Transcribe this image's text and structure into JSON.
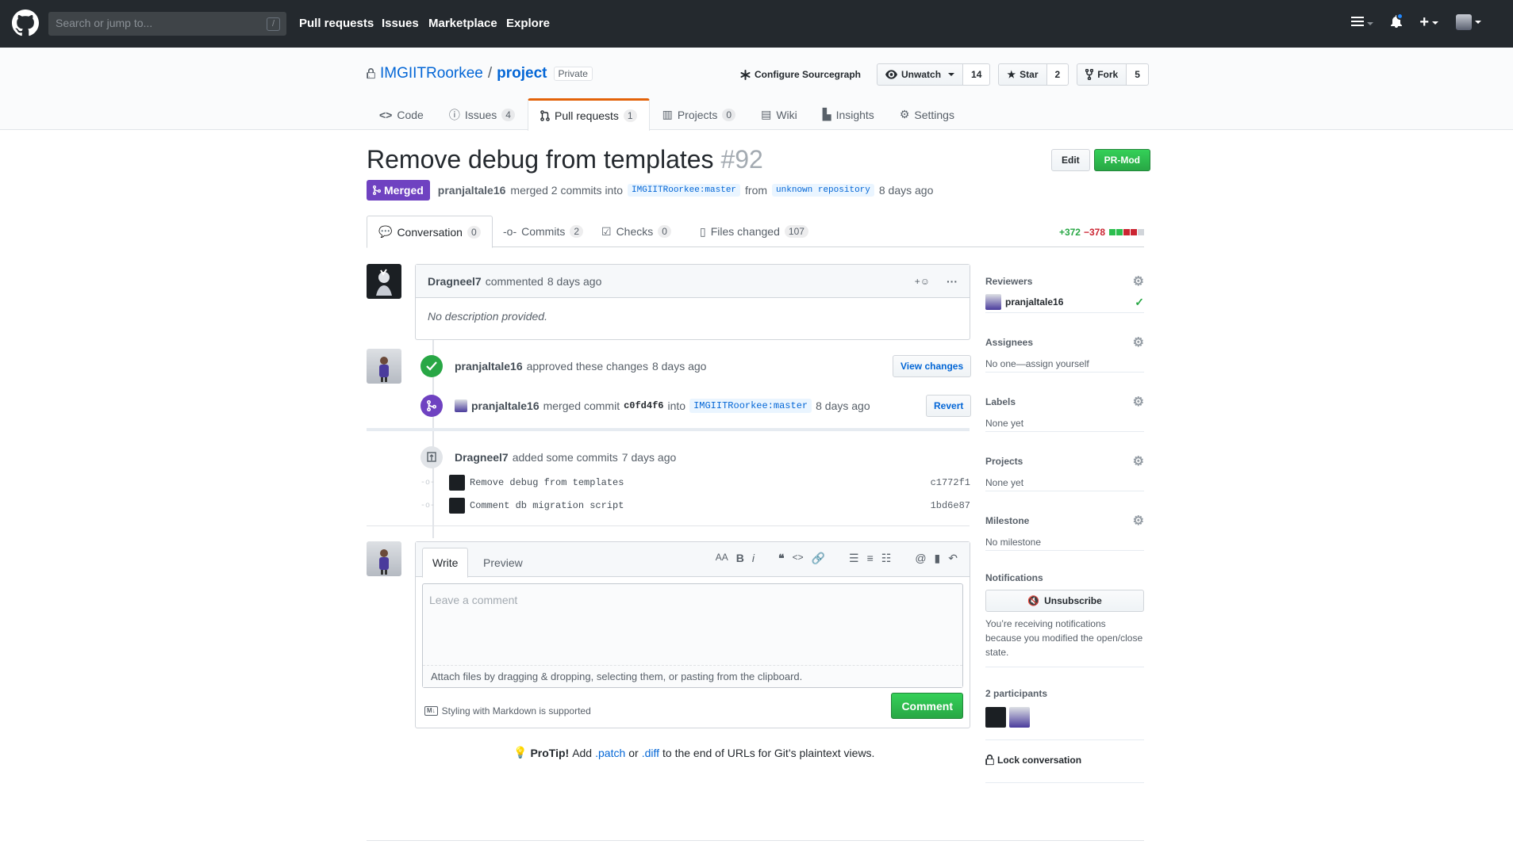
{
  "header": {
    "search_placeholder": "Search or jump to...",
    "search_shortcut": "/",
    "nav": [
      "Pull requests",
      "Issues",
      "Marketplace",
      "Explore"
    ]
  },
  "repo": {
    "owner": "IMGIITRoorkee",
    "separator": "/",
    "name": "project",
    "visibility": "Private",
    "sourcegraph_label": "Configure Sourcegraph",
    "watch_label": "Unwatch",
    "watch_count": "14",
    "star_label": "Star",
    "star_count": "2",
    "fork_label": "Fork",
    "fork_count": "5",
    "tabs": [
      {
        "label": "Code",
        "count": ""
      },
      {
        "label": "Issues",
        "count": "4"
      },
      {
        "label": "Pull requests",
        "count": "1"
      },
      {
        "label": "Projects",
        "count": "0"
      },
      {
        "label": "Wiki",
        "count": ""
      },
      {
        "label": "Insights",
        "count": ""
      },
      {
        "label": "Settings",
        "count": ""
      }
    ]
  },
  "pr": {
    "title": "Remove debug from templates",
    "number": "#92",
    "edit_label": "Edit",
    "prmod_label": "PR-Mod",
    "state": "Merged",
    "author": "pranjaltale16",
    "merged_text": "merged 2 commits into",
    "base_branch": "IMGIITRoorkee:master",
    "from_text": "from",
    "head_branch": "unknown repository",
    "time": "8 days ago",
    "tabs": [
      {
        "label": "Conversation",
        "count": "0"
      },
      {
        "label": "Commits",
        "count": "2"
      },
      {
        "label": "Checks",
        "count": "0"
      },
      {
        "label": "Files changed",
        "count": "107"
      }
    ],
    "additions": "+372",
    "deletions": "−378"
  },
  "timeline": {
    "comment": {
      "author": "Dragneel7",
      "action": "commented",
      "time": "8 days ago",
      "body": "No description provided."
    },
    "approval": {
      "author": "pranjaltale16",
      "action": "approved these changes",
      "time": "8 days ago",
      "button": "View changes"
    },
    "merge": {
      "author": "pranjaltale16",
      "action": "merged commit",
      "sha": "c0fd4f6",
      "into_text": "into",
      "branch": "IMGIITRoorkee:master",
      "time": "8 days ago",
      "button": "Revert"
    },
    "commits_event": {
      "author": "Dragneel7",
      "action": "added some commits",
      "time": "7 days ago"
    },
    "commits": [
      {
        "message": "Remove debug from templates",
        "sha": "c1772f1"
      },
      {
        "message": "Comment db migration script",
        "sha": "1bd6e87"
      }
    ]
  },
  "comment_form": {
    "write_tab": "Write",
    "preview_tab": "Preview",
    "placeholder": "Leave a comment",
    "attach_text": "Attach files by dragging & dropping, selecting them, or pasting from the clipboard.",
    "markdown_note": "Styling with Markdown is supported",
    "submit_label": "Comment",
    "toolbar": {
      "heading": "AA",
      "bold": "B",
      "italic": "i"
    }
  },
  "protip": {
    "label": "ProTip!",
    "text_before": "Add",
    "patch": ".patch",
    "or": "or",
    "diff": ".diff",
    "text_after": "to the end of URLs for Git’s plaintext views."
  },
  "sidebar": {
    "reviewers_label": "Reviewers",
    "reviewer": "pranjaltale16",
    "assignees_label": "Assignees",
    "assignees_value": "No one—assign yourself",
    "labels_label": "Labels",
    "labels_value": "None yet",
    "projects_label": "Projects",
    "projects_value": "None yet",
    "milestone_label": "Milestone",
    "milestone_value": "No milestone",
    "notifications_label": "Notifications",
    "unsubscribe_label": "Unsubscribe",
    "notifications_note": "You’re receiving notifications because you modified the open/close state.",
    "participants_label": "2 participants",
    "lock_label": "Lock conversation"
  },
  "colors": {
    "merged": "#6f42c1",
    "green": "#28a745",
    "link": "#0366d6",
    "header_bg": "#24292e"
  }
}
